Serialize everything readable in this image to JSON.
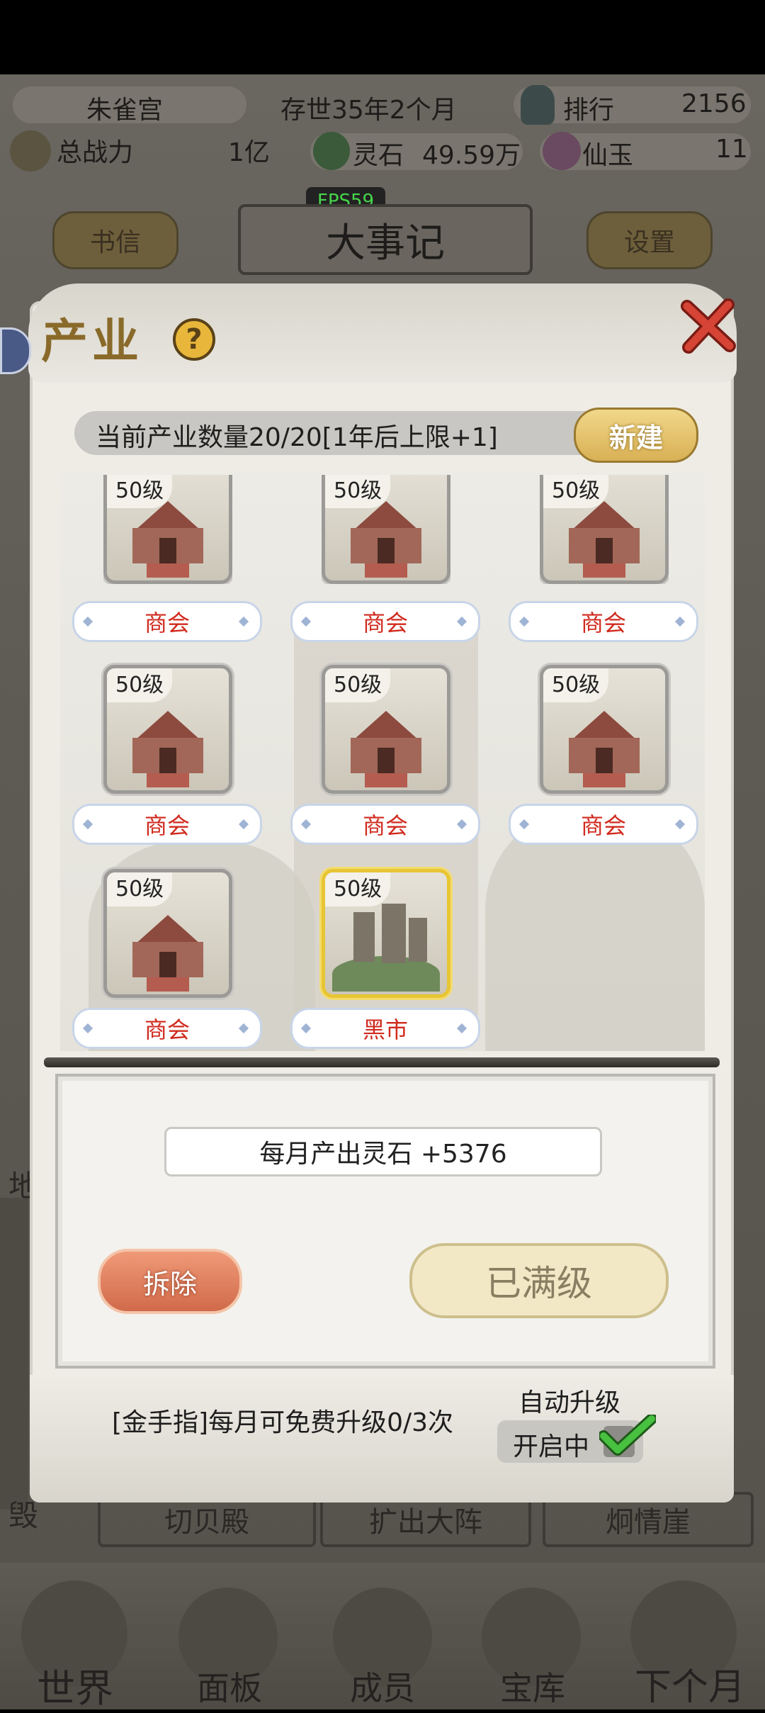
{
  "hud": {
    "location": "朱雀宫",
    "survival": "存世35年2个月",
    "rank_label": "排行",
    "rank_value": "2156",
    "power_label": "总战力",
    "power_value": "1亿",
    "spirit_stone_label": "灵石",
    "spirit_stone_value": "49.59万",
    "jade_label": "仙玉",
    "jade_value": "11"
  },
  "fps": "FPS59",
  "background_buttons": {
    "letters": "书信",
    "events": "大事记",
    "settings": "设置",
    "row_labels": [
      "切贝殿",
      "扩出大阵",
      "炯情崖"
    ],
    "side_char": "毁",
    "side_char2": "地"
  },
  "panel": {
    "title": "产业",
    "help_symbol": "?",
    "count_text": "当前产业数量20/20[1年后上限+1]",
    "new_button": "新建"
  },
  "industries": [
    {
      "level": "50级",
      "name": "商会",
      "type": "guild",
      "selected": false
    },
    {
      "level": "50级",
      "name": "商会",
      "type": "guild",
      "selected": false
    },
    {
      "level": "50级",
      "name": "商会",
      "type": "guild",
      "selected": false
    },
    {
      "level": "50级",
      "name": "商会",
      "type": "guild",
      "selected": false
    },
    {
      "level": "50级",
      "name": "商会",
      "type": "guild",
      "selected": false
    },
    {
      "level": "50级",
      "name": "商会",
      "type": "guild",
      "selected": false
    },
    {
      "level": "50级",
      "name": "商会",
      "type": "guild",
      "selected": false
    },
    {
      "level": "50级",
      "name": "黑市",
      "type": "market",
      "selected": true
    }
  ],
  "detail": {
    "income": "每月产出灵石 +5376",
    "demolish_button": "拆除",
    "max_level_button": "已满级"
  },
  "footer": {
    "golden_finger": "[金手指]每月可免费升级0/3次",
    "auto_upgrade_label": "自动升级",
    "auto_upgrade_state": "开启中",
    "auto_upgrade_checked": true
  },
  "bottom_nav": [
    "世界",
    "面板",
    "成员",
    "宝库",
    "下个月"
  ],
  "colors": {
    "accent_gold": "#d9b055",
    "name_red": "#d02a1e",
    "demolish": "#d06a4a",
    "check_green": "#3fae3a"
  }
}
